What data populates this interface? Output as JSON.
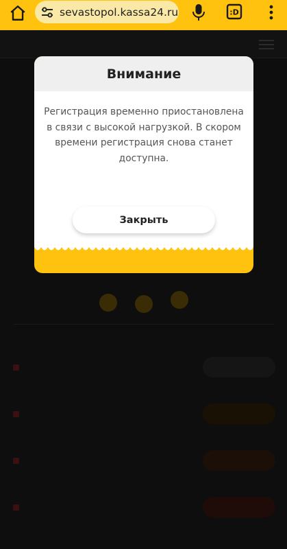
{
  "browser": {
    "url": "sevastopol.kassa24.ru/e",
    "tab_count": ":D",
    "accent_color": "#ffc20e",
    "icons": [
      "home-icon",
      "site-settings-icon",
      "mic-icon",
      "tabs-icon",
      "more-icon"
    ]
  },
  "modal": {
    "title": "Внимание",
    "message": "Регистрация временно приостановлена в связи с высокой нагрузкой. В скором времени регистрация снова станет доступна.",
    "close_label": "Закрыть"
  }
}
